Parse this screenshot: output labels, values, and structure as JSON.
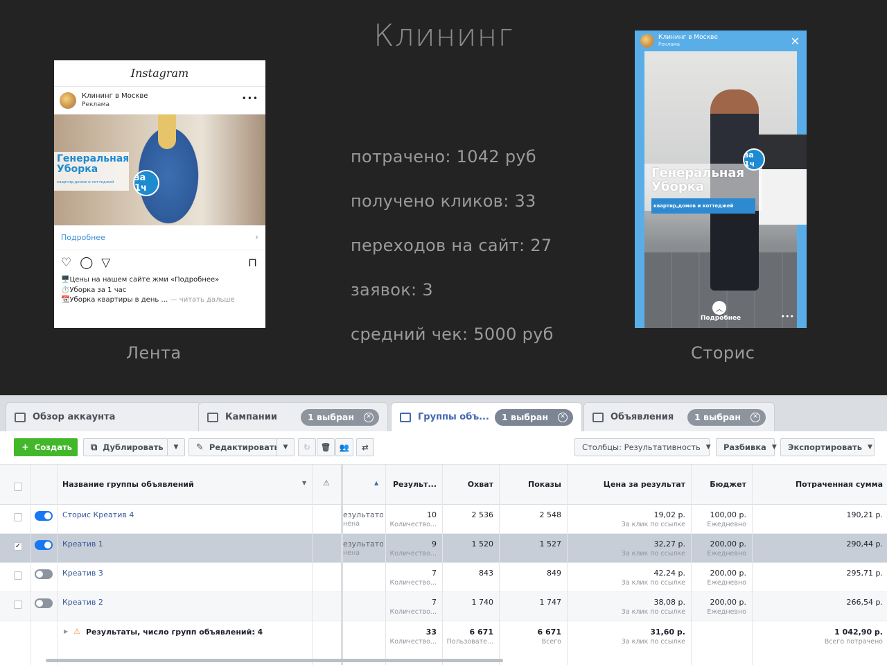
{
  "slide": {
    "title": "Клининг",
    "stats": [
      "потрачено: 1042 руб",
      "получено кликов: 33",
      "переходов на сайт: 27",
      "заявок: 3",
      "средний чек: 5000 руб"
    ],
    "feed_caption": "Лента",
    "stories_caption": "Сторис"
  },
  "feed": {
    "app_name": "Instagram",
    "account": "Клининг в Москве",
    "sponsored": "Реклама",
    "menu": "•••",
    "banner_title": "Генеральная Уборка",
    "banner_sub": "квартир,домов и коттеджей",
    "badge": "за 1ч",
    "more_label": "Подробнее",
    "caption_lines": [
      "🖥️Цены на нашем сайте жми «Подробнее»",
      "⏱️Уборка за 1 час",
      "📆Уборка квартиры в день …"
    ],
    "read_more": " — читать дальше"
  },
  "story": {
    "account": "Клининг в Москве",
    "sponsored": "Реклама",
    "banner_title": "Генеральная Уборка",
    "banner_sub": "квартир,домов и коттеджей",
    "badge": "за 1ч",
    "more_label": "Подробнее",
    "menu": "•••"
  },
  "tabs": [
    {
      "label": "Обзор аккаунта"
    },
    {
      "label": "Кампании",
      "pill": "1 выбран"
    },
    {
      "label": "Группы объ...",
      "pill": "1 выбран"
    },
    {
      "label": "Объявления",
      "pill": "1 выбран"
    }
  ],
  "toolbar": {
    "create": "Создать",
    "duplicate": "Дублировать",
    "edit": "Редактировать",
    "columns": "Столбцы: Результативность",
    "breakdown": "Разбивка",
    "export": "Экспортировать"
  },
  "table": {
    "headers": {
      "name": "Название группы объявлений",
      "results": "Результ...",
      "reach": "Охват",
      "impressions": "Показы",
      "cost": "Цена за результат",
      "budget": "Бюджет",
      "spent": "Потраченная сумма"
    },
    "rows": [
      {
        "name": "Сторис Креатив 4",
        "delivery": "езультатов",
        "delivery_sub": "нена",
        "results": "10",
        "results_sub": "Количество...",
        "reach": "2 536",
        "impressions": "2 548",
        "cost": "19,02 р.",
        "cost_sub": "За клик по ссылке",
        "budget": "100,00 р.",
        "budget_sub": "Ежедневно",
        "spent": "190,21 р.",
        "active": true,
        "checked": false
      },
      {
        "name": "Креатив 1",
        "delivery": "езультатов",
        "delivery_sub": "нена",
        "results": "9",
        "results_sub": "Количество...",
        "reach": "1 520",
        "impressions": "1 527",
        "cost": "32,27 р.",
        "cost_sub": "За клик по ссылке",
        "budget": "200,00 р.",
        "budget_sub": "Ежедневно",
        "spent": "290,44 р.",
        "active": true,
        "checked": true
      },
      {
        "name": "Креатив 3",
        "delivery": "",
        "delivery_sub": "",
        "results": "7",
        "results_sub": "Количество...",
        "reach": "843",
        "impressions": "849",
        "cost": "42,24 р.",
        "cost_sub": "За клик по ссылке",
        "budget": "200,00 р.",
        "budget_sub": "Ежедневно",
        "spent": "295,71 р.",
        "active": false,
        "checked": false
      },
      {
        "name": "Креатив 2",
        "delivery": "",
        "delivery_sub": "",
        "results": "7",
        "results_sub": "Количество...",
        "reach": "1 740",
        "impressions": "1 747",
        "cost": "38,08 р.",
        "cost_sub": "За клик по ссылке",
        "budget": "200,00 р.",
        "budget_sub": "Ежедневно",
        "spent": "266,54 р.",
        "active": false,
        "checked": false
      }
    ],
    "total": {
      "label": "Результаты, число групп объявлений: 4",
      "results": "33",
      "results_sub": "Количество...",
      "reach": "6 671",
      "reach_sub": "Пользовате...",
      "impressions": "6 671",
      "impressions_sub": "Всего",
      "cost": "31,60 р.",
      "cost_sub": "За клик по ссылке",
      "spent": "1 042,90 р.",
      "spent_sub": "Всего потрачено"
    }
  },
  "colors": {
    "accent": "#4267b2",
    "create_green": "#42b72a",
    "toggle_on": "#1877f2",
    "selected_row": "#c7ced7"
  }
}
